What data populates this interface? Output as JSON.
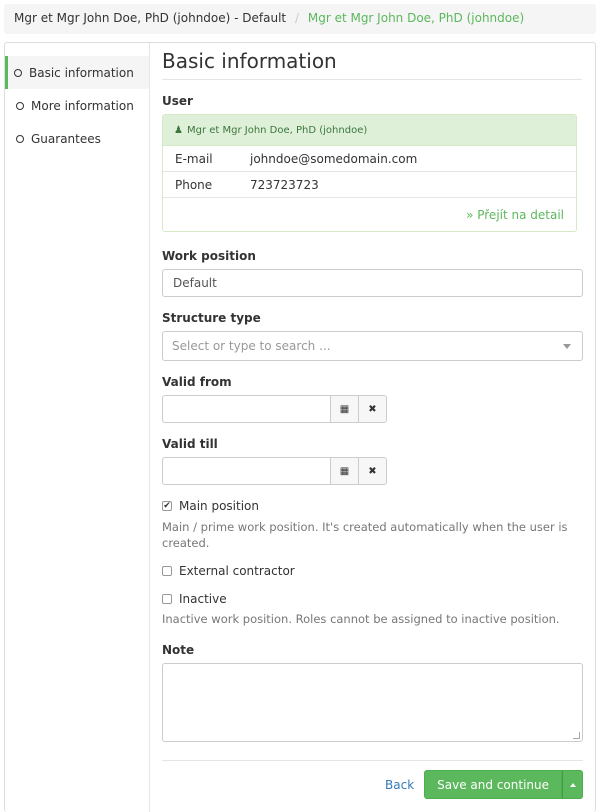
{
  "breadcrumb": {
    "items": [
      "Mgr et Mgr John Doe, PhD (johndoe) - Default"
    ],
    "separator": "/",
    "active": "Mgr et Mgr John Doe, PhD (johndoe)"
  },
  "sidebar": {
    "items": [
      {
        "label": "Basic information",
        "active": true
      },
      {
        "label": "More information",
        "active": false
      },
      {
        "label": "Guarantees",
        "active": false
      }
    ]
  },
  "main": {
    "title": "Basic information",
    "user": {
      "label": "User",
      "name": "Mgr et Mgr John Doe, PhD (johndoe)",
      "rows": [
        {
          "key": "E-mail",
          "value": "johndoe@somedomain.com"
        },
        {
          "key": "Phone",
          "value": "723723723"
        }
      ],
      "detail_link": "» Přejít na detail"
    },
    "work_position": {
      "label": "Work position",
      "value": "Default"
    },
    "structure_type": {
      "label": "Structure type",
      "placeholder": "Select or type to search ..."
    },
    "valid_from": {
      "label": "Valid from",
      "value": ""
    },
    "valid_till": {
      "label": "Valid till",
      "value": ""
    },
    "main_position": {
      "label": "Main position",
      "checked": true,
      "help": "Main / prime work position. It's created automatically when the user is created."
    },
    "external_contractor": {
      "label": "External contractor",
      "checked": false
    },
    "inactive": {
      "label": "Inactive",
      "checked": false,
      "help": "Inactive work position. Roles cannot be assigned to inactive position."
    },
    "note": {
      "label": "Note",
      "value": ""
    },
    "footer": {
      "back_label": "Back",
      "save_label": "Save and continue"
    }
  },
  "icons": {
    "calendar": "calendar-icon",
    "clear": "clear-icon",
    "user": "user-icon",
    "check": "✔"
  },
  "colors": {
    "accent": "#5cb85c",
    "link": "#337ab7"
  }
}
